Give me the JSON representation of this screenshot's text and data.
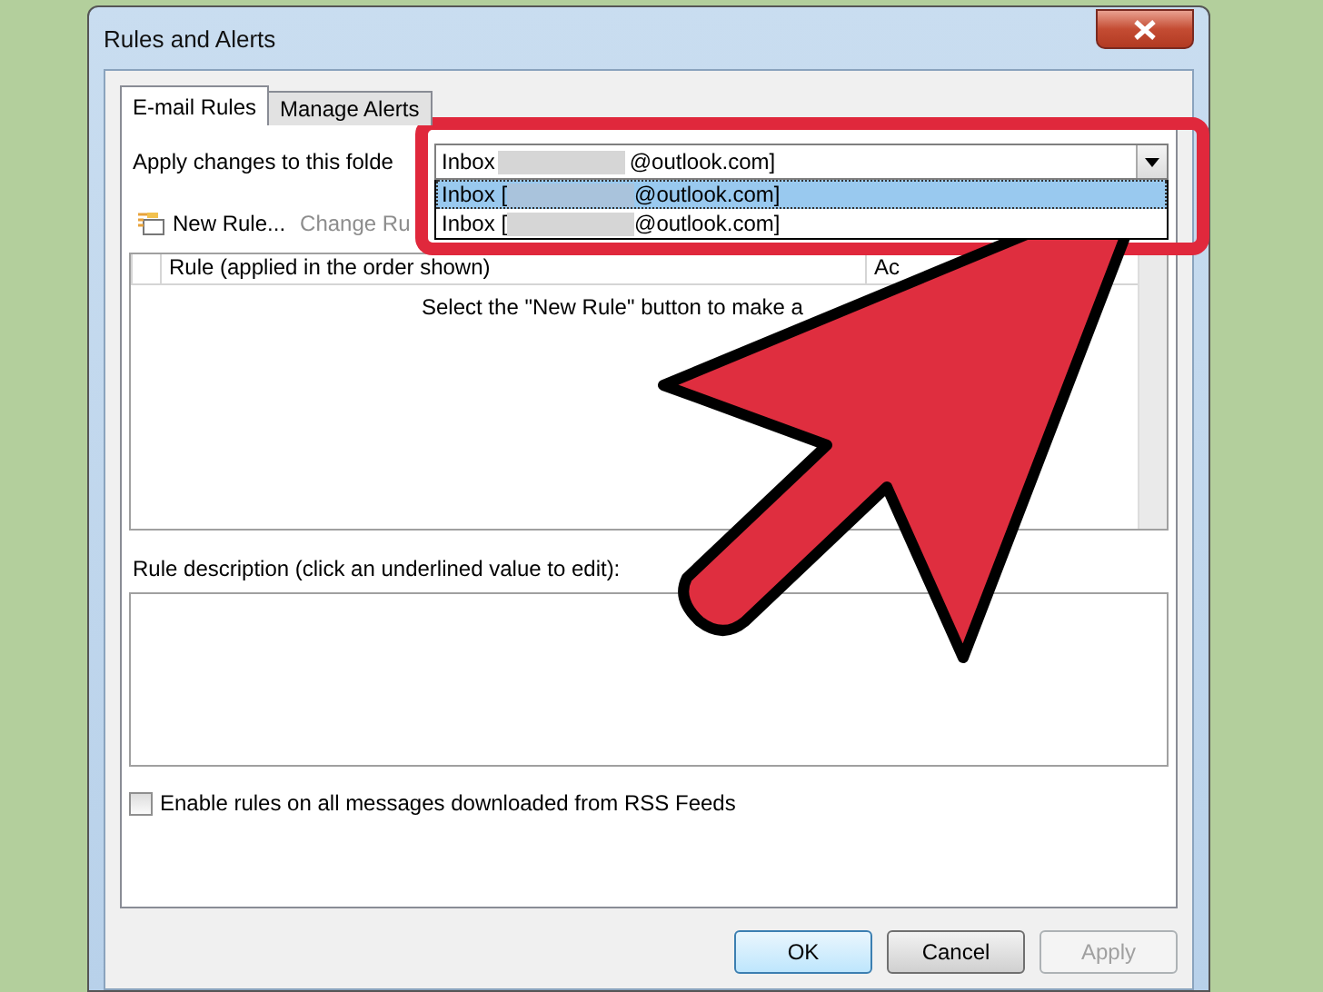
{
  "window": {
    "title": "Rules and Alerts"
  },
  "tabs": [
    {
      "label": "E-mail Rules",
      "selected": true
    },
    {
      "label": "Manage Alerts",
      "selected": false
    }
  ],
  "folder": {
    "label": "Apply changes to this folde",
    "value_prefix": "Inbox",
    "value_suffix": "@outlook.com]",
    "expanded": true,
    "options": [
      {
        "prefix": "Inbox [",
        "suffix": "@outlook.com]",
        "selected": true
      },
      {
        "prefix": "Inbox [",
        "suffix": "@outlook.com]",
        "selected": false
      }
    ]
  },
  "toolbar": [
    {
      "kind": "new",
      "label": "New Rule...",
      "disabled": false
    },
    {
      "kind": "plain",
      "label": "Change Ru",
      "disabled": true
    }
  ],
  "rules_table": {
    "columns": [
      "Rule (applied in the order shown)",
      "Ac"
    ],
    "empty_message": "Select the \"New Rule\" button to make a"
  },
  "description": {
    "label": "Rule description (click an underlined value to edit):"
  },
  "rss": {
    "label": "Enable rules on all messages downloaded from RSS Feeds",
    "checked": false
  },
  "buttons": [
    {
      "label": "OK",
      "default": true,
      "disabled": false
    },
    {
      "label": "Cancel",
      "default": false,
      "disabled": false
    },
    {
      "label": "Apply",
      "default": false,
      "disabled": true
    }
  ]
}
